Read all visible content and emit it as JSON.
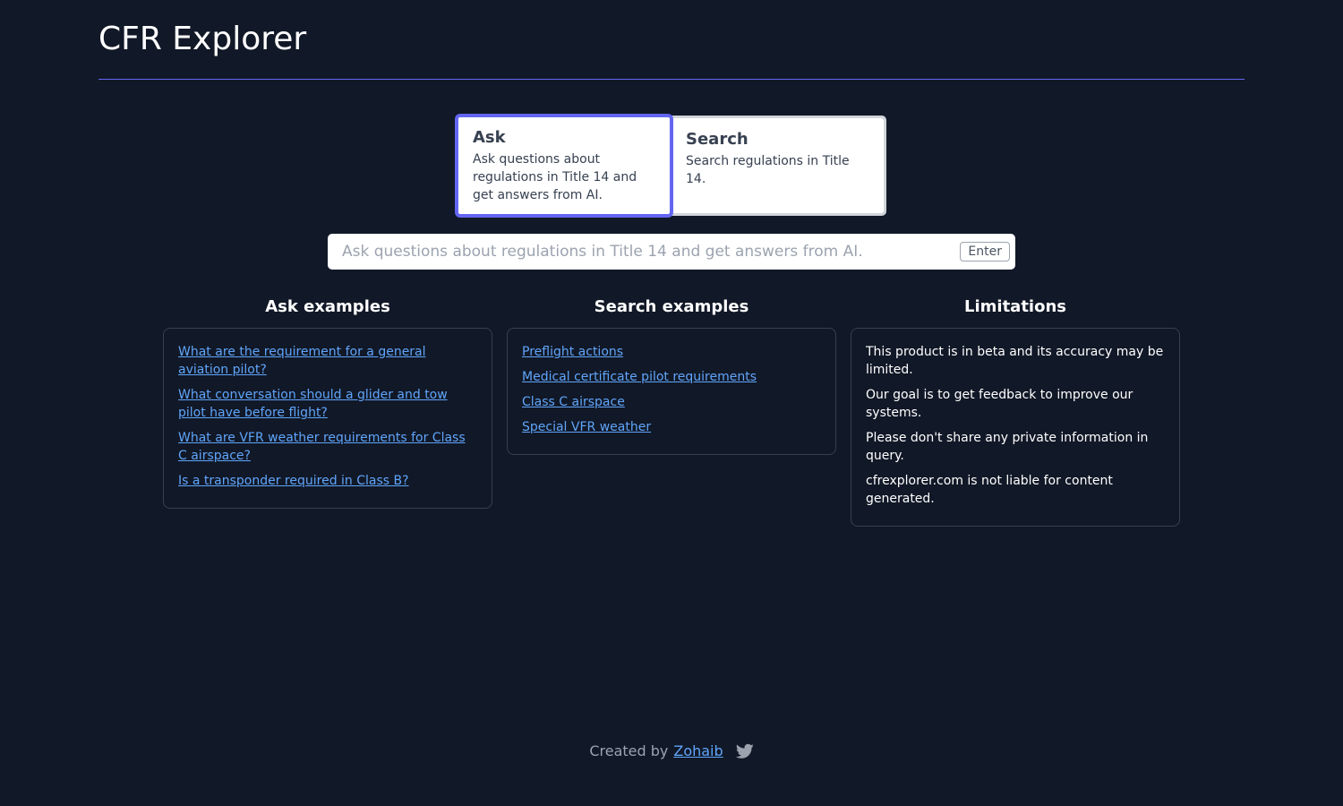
{
  "header": {
    "title": "CFR Explorer"
  },
  "modes": [
    {
      "title": "Ask",
      "description": "Ask questions about regulations in Title 14 and get answers from AI.",
      "active": true
    },
    {
      "title": "Search",
      "description": "Search regulations in Title 14.",
      "active": false
    }
  ],
  "search": {
    "placeholder": "Ask questions about regulations in Title 14 and get answers from AI.",
    "value": "",
    "enter_label": "Enter"
  },
  "ask_examples": {
    "heading": "Ask examples",
    "items": [
      "What are the requirement for a general aviation pilot?",
      "What conversation should a glider and tow pilot have before flight?",
      "What are VFR weather requirements for Class C airspace?",
      "Is a transponder required in Class B?"
    ]
  },
  "search_examples": {
    "heading": "Search examples",
    "items": [
      "Preflight actions",
      "Medical certificate pilot requirements",
      "Class C airspace",
      "Special VFR weather"
    ]
  },
  "limitations": {
    "heading": "Limitations",
    "items": [
      "This product is in beta and its accuracy may be limited.",
      "Our goal is to get feedback to improve our systems.",
      "Please don't share any private information in query.",
      "cfrexplorer.com is not liable for content generated."
    ]
  },
  "footer": {
    "prefix": "Created by",
    "author": "Zohaib",
    "social_icon": "twitter-icon"
  },
  "colors": {
    "background": "#111827",
    "accent": "#6366f1",
    "link": "#60a5fa"
  }
}
